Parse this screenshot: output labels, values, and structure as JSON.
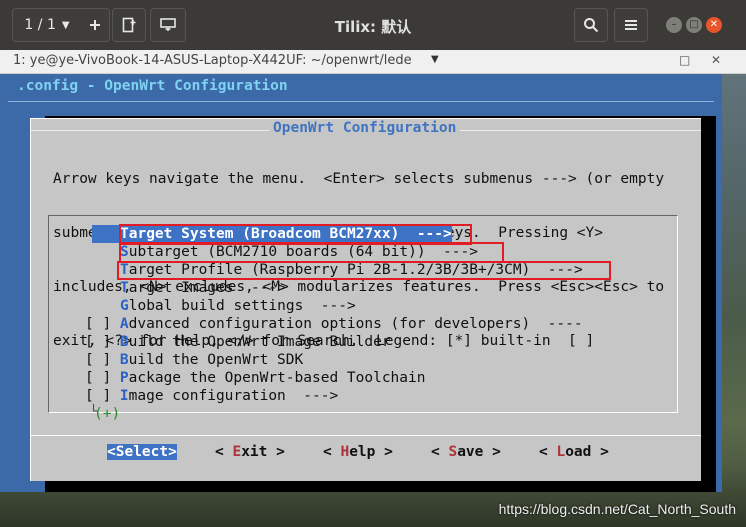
{
  "window": {
    "title": "Tilix: 默认",
    "pager": "1 / 1",
    "add_icon": "plus-icon",
    "new_session_icon": "new-session-icon",
    "split_icon": "split-icon",
    "search_icon": "search-icon",
    "menu_icon": "hamburger-icon"
  },
  "session": {
    "title": "1: ye@ye-VivoBook-14-ASUS-Laptop-X442UF: ~/openwrt/lede"
  },
  "terminal": {
    "header": ".config - OpenWrt Configuration",
    "dialog_title": "OpenWrt Configuration",
    "help_lines": [
      "Arrow keys navigate the menu.  <Enter> selects submenus ---> (or empty",
      "submenus ----).  Highlighted letters are hotkeys.  Pressing <Y>",
      "includes, <N> excludes, <M> modularizes features.  Press <Esc><Esc> to",
      "exit, <?> for Help, </> for Search.  Legend: [*] built-in  [ ]"
    ],
    "menu_items": [
      {
        "prefix": "    ",
        "hot": "T",
        "rest": "arget System (Broadcom BCM27xx)  --->"
      },
      {
        "prefix": "    ",
        "hot": "S",
        "rest": "ubtarget (BCM2710 boards (64 bit))  --->"
      },
      {
        "prefix": "    ",
        "hot": "T",
        "rest": "arget Profile (Raspberry Pi 2B-1.2/3B/3B+/3CM)  --->"
      },
      {
        "prefix": "    ",
        "hot": "T",
        "rest": "arget Images  --->"
      },
      {
        "prefix": "    ",
        "hot": "G",
        "rest": "lobal build settings  --->"
      },
      {
        "prefix": "[ ] ",
        "hot": "A",
        "rest": "dvanced configuration options (for developers)  ----"
      },
      {
        "prefix": "[ ] ",
        "hot": "B",
        "rest": "uild the OpenWrt Image Builder"
      },
      {
        "prefix": "[ ] ",
        "hot": "B",
        "rest": "uild the OpenWrt SDK"
      },
      {
        "prefix": "[ ] ",
        "hot": "P",
        "rest": "ackage the OpenWrt-based Toolchain"
      },
      {
        "prefix": "[ ] ",
        "hot": "I",
        "rest": "mage configuration  --->"
      }
    ],
    "more_indicator": "(+)",
    "buttons": [
      {
        "open": "<",
        "key": "S",
        "rest": "elect",
        "close": ">"
      },
      {
        "open": "< ",
        "key": "E",
        "rest": "xit",
        "close": " >"
      },
      {
        "open": "< ",
        "key": "H",
        "rest": "elp",
        "close": " >"
      },
      {
        "open": "< ",
        "key": "S",
        "rest": "ave",
        "close": " >"
      },
      {
        "open": "< ",
        "key": "L",
        "rest": "oad",
        "close": " >"
      }
    ]
  },
  "watermark": "https://blog.csdn.net/Cat_North_South",
  "colors": {
    "terminal_bg": "#3c69a8",
    "dialog_bg": "#c6c6c6",
    "highlight": "#3e72c4",
    "annotation_red": "#e21b25"
  }
}
